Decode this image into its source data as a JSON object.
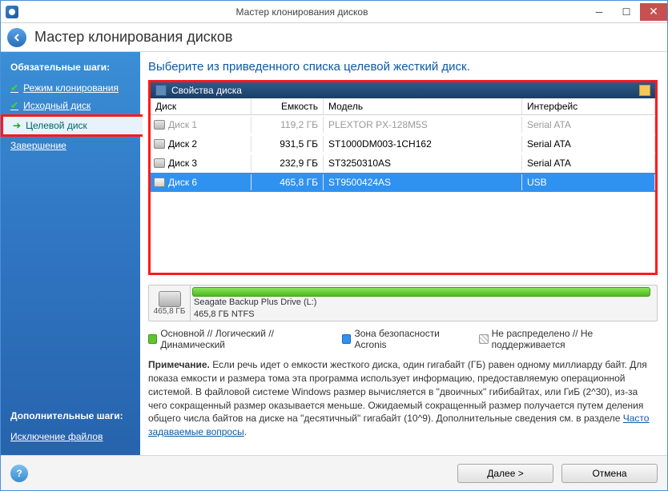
{
  "window": {
    "title": "Мастер клонирования дисков"
  },
  "header": {
    "title": "Мастер клонирования дисков"
  },
  "sidebar": {
    "required_title": "Обязательные шаги:",
    "steps": [
      {
        "label": "Режим клонирования",
        "done": true
      },
      {
        "label": "Исходный диск",
        "done": true
      },
      {
        "label": "Целевой диск",
        "active": true
      },
      {
        "label": "Завершение"
      }
    ],
    "optional_title": "Дополнительные шаги:",
    "optional": [
      {
        "label": "Исключение файлов"
      }
    ]
  },
  "content": {
    "instruction": "Выберите из приведенного списка целевой жесткий диск.",
    "panel_title": "Свойства диска",
    "columns": {
      "disk": "Диск",
      "cap": "Емкость",
      "model": "Модель",
      "if": "Интерфейс"
    },
    "rows": [
      {
        "disk": "Диск 1",
        "cap": "119,2 ГБ",
        "model": "PLEXTOR PX-128M5S",
        "if": "Serial ATA",
        "dim": true
      },
      {
        "disk": "Диск 2",
        "cap": "931,5 ГБ",
        "model": "ST1000DM003-1CH162",
        "if": "Serial ATA"
      },
      {
        "disk": "Диск 3",
        "cap": "232,9 ГБ",
        "model": "ST3250310AS",
        "if": "Serial ATA"
      },
      {
        "disk": "Диск 6",
        "cap": "465,8 ГБ",
        "model": "ST9500424AS",
        "if": "USB",
        "selected": true
      }
    ],
    "disk_visual": {
      "size": "465,8 ГБ",
      "name": "Seagate Backup Plus Drive (L:)",
      "part": "465,8 ГБ  NTFS"
    },
    "legend": {
      "l1": "Основной // Логический // Динамический",
      "l2": "Зона безопасности Acronis",
      "l3": "Не распределено // Не поддерживается"
    },
    "note_bold": "Примечание.",
    "note_text": " Если речь идет о емкости жесткого диска, один гигабайт (ГБ) равен одному миллиарду байт. Для показа емкости и размера тома эта программа использует информацию, предоставляемую операционной системой. В файловой системе Windows размер вычисляется в \"двоичных\" гибибайтах, или ГиБ (2^30), из-за чего сокращенный размер оказывается меньше. Ожидаемый сокращенный размер получается путем деления общего числа байтов на диске на \"десятичный\" гигабайт (10^9). Дополнительные сведения см. в разделе ",
    "note_link": "Часто задаваемые вопросы",
    "note_after": "."
  },
  "footer": {
    "next": "Далее >",
    "cancel": "Отмена"
  }
}
